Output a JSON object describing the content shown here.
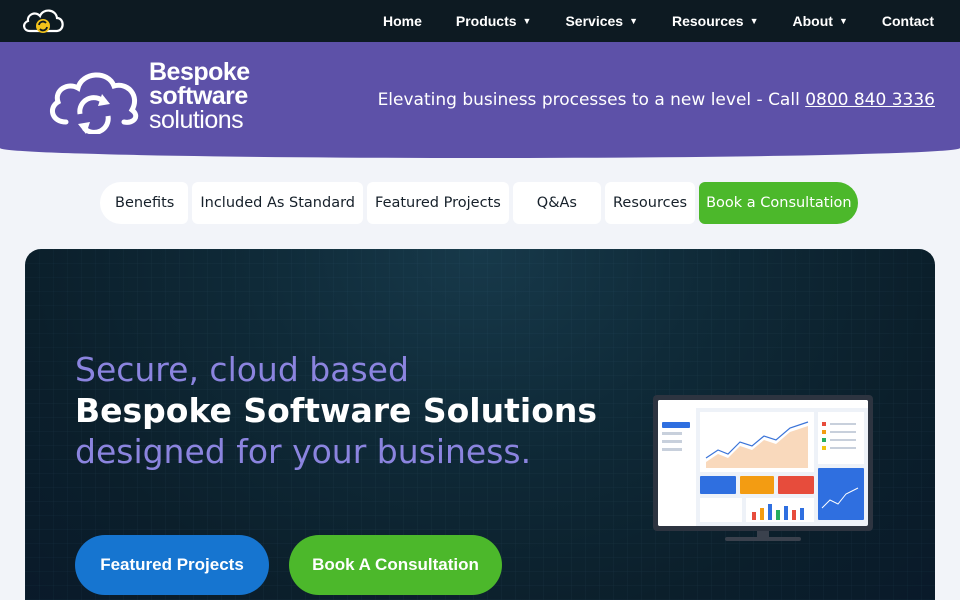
{
  "topnav": {
    "items": [
      {
        "label": "Home",
        "dropdown": false
      },
      {
        "label": "Products",
        "dropdown": true
      },
      {
        "label": "Services",
        "dropdown": true
      },
      {
        "label": "Resources",
        "dropdown": true
      },
      {
        "label": "About",
        "dropdown": true
      },
      {
        "label": "Contact",
        "dropdown": false
      }
    ],
    "caret": "▼"
  },
  "banner": {
    "logo": {
      "line1": "Bespoke",
      "line2": "software",
      "line3": "solutions"
    },
    "tagline": "Elevating business processes to a new level - Call ",
    "phone": "0800 840 3336"
  },
  "tabs": [
    {
      "label": "Benefits"
    },
    {
      "label": "Included As Standard"
    },
    {
      "label": "Featured Projects"
    },
    {
      "label": "Q&As"
    },
    {
      "label": "Resources"
    },
    {
      "label": "Book a Consultation"
    }
  ],
  "hero": {
    "line1": "Secure, cloud based",
    "line2": "Bespoke Software Solutions",
    "line3": "designed for your business.",
    "btn_featured": "Featured Projects",
    "btn_book": "Book A Consultation"
  },
  "colors": {
    "nav_bg": "#0d1a22",
    "banner": "#5d51a8",
    "accent_green": "#4cb82b",
    "accent_blue": "#1675d0",
    "hero_lilac": "#8b84df"
  }
}
